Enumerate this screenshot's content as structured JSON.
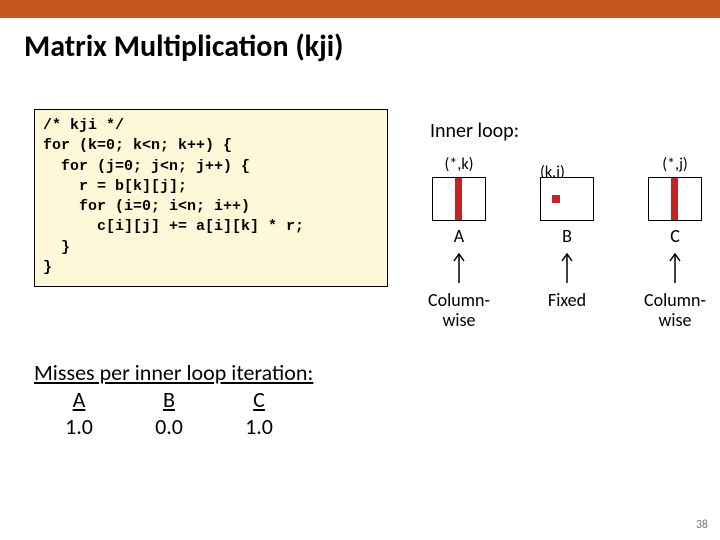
{
  "title": "Matrix Multiplication (kji)",
  "code": "/* kji */\nfor (k=0; k<n; k++) {\n  for (j=0; j<n; j++) {\n    r = b[k][j];\n    for (i=0; i<n; i++)\n      c[i][j] += a[i][k] * r;\n  }\n}",
  "inner_loop_label": "Inner loop:",
  "matrices": {
    "A": {
      "coord": "(*,k)",
      "name": "A",
      "pattern": "Column-\nwise"
    },
    "B": {
      "coord": "(k,j)",
      "name": "B",
      "pattern": "Fixed"
    },
    "C": {
      "coord": "(*,j)",
      "name": "C",
      "pattern": "Column-\nwise"
    }
  },
  "misses": {
    "heading": "Misses per inner loop iteration:",
    "cols": [
      "A",
      "B",
      "C"
    ],
    "vals": [
      "1.0",
      "0.0",
      "1.0"
    ]
  },
  "page": "38"
}
